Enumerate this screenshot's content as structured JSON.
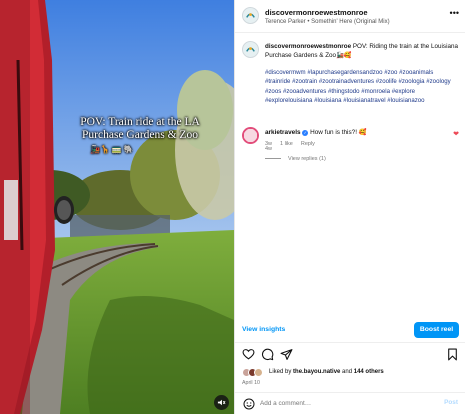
{
  "post": {
    "username": "discovermonroewestmonroe",
    "audio": "Terence Parker • Somethin' Here (Original Mix)",
    "more_icon": "more-horizontal-icon"
  },
  "caption": {
    "username": "discovermonroewestmonroe",
    "text": "POV: Riding the train at the Louisiana Purchase Gardens & Zoo🚂🥰",
    "hashtags": "#discovermwm #lapurchasegardensandzoo #zoo #zooanimals #trainride #zootrain #zootrainadventures #zoolife #zoologia #zoology #zoos #zooadventures #thingstodo #monroela #explore #explorelouisiana #louisiana #louisianatravel #louisianazoo",
    "ago": "4w"
  },
  "comment": {
    "username": "arkietravels",
    "text": "How fun is this?! 🥰",
    "ago": "3w",
    "likes": "1 like",
    "reply": "Reply",
    "view_replies": "View replies (1)"
  },
  "video": {
    "overlay_title": "POV: Train ride at the LA Purchase Gardens & Zoo",
    "overlay_sub": "🚂🦒 🚃 🐘",
    "mute_icon": "speaker-muted-icon"
  },
  "toolbar": {
    "view_insights": "View insights",
    "boost_reel": "Boost reel"
  },
  "engagement": {
    "liked_by_prefix": "Liked by",
    "liked_by_user": "the.bayou.native",
    "and": "and",
    "count": "144 others",
    "date": "April 10"
  },
  "add_comment": {
    "placeholder": "Add a comment…",
    "post_label": "Post"
  },
  "colors": {
    "accent": "#0095f6",
    "hashtag": "#1f3a8a",
    "heart": "#ed4956"
  }
}
